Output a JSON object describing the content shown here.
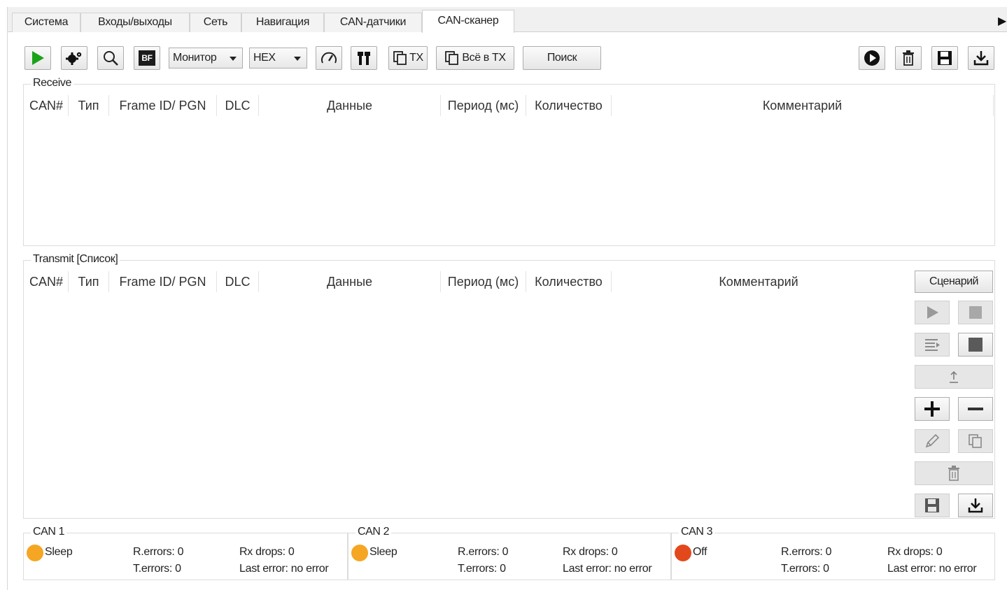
{
  "tabs": [
    "Система",
    "Входы/выходы",
    "Сеть",
    "Навигация",
    "CAN-датчики",
    "CAN-сканер"
  ],
  "active_tab": "CAN-сканер",
  "toolbar": {
    "mode_select": "Монитор",
    "format_select": "HEX",
    "copy_tx_label": "TX",
    "all_to_tx_label": "Всё в TX",
    "search_label": "Поиск",
    "bf_label": "BF"
  },
  "receive": {
    "title": "Receive",
    "columns": [
      "CAN#",
      "Тип",
      "Frame ID/ PGN",
      "DLC",
      "Данные",
      "Период (мс)",
      "Количество",
      "Комментарий"
    ]
  },
  "transmit": {
    "title": "Transmit [Список]",
    "columns": [
      "CAN#",
      "Тип",
      "Frame ID/ PGN",
      "DLC",
      "Данные",
      "Период (мс)",
      "Количество",
      "Комментарий"
    ],
    "scenario_label": "Сценарий"
  },
  "can_channels": [
    {
      "name": "CAN 1",
      "state": "Sleep",
      "state_color": "#f5a623",
      "r_errors": "R.errors: 0",
      "t_errors": "T.errors: 0",
      "rx_drops": "Rx drops: 0",
      "last_error": "Last error: no error"
    },
    {
      "name": "CAN 2",
      "state": "Sleep",
      "state_color": "#f5a623",
      "r_errors": "R.errors: 0",
      "t_errors": "T.errors: 0",
      "rx_drops": "Rx drops: 0",
      "last_error": "Last error: no error"
    },
    {
      "name": "CAN 3",
      "state": "Off",
      "state_color": "#e2481b",
      "r_errors": "R.errors: 0",
      "t_errors": "T.errors: 0",
      "rx_drops": "Rx drops: 0",
      "last_error": "Last error: no error"
    }
  ],
  "colors": {
    "play_green": "#1aa31a",
    "accent_border": "#adadad"
  }
}
